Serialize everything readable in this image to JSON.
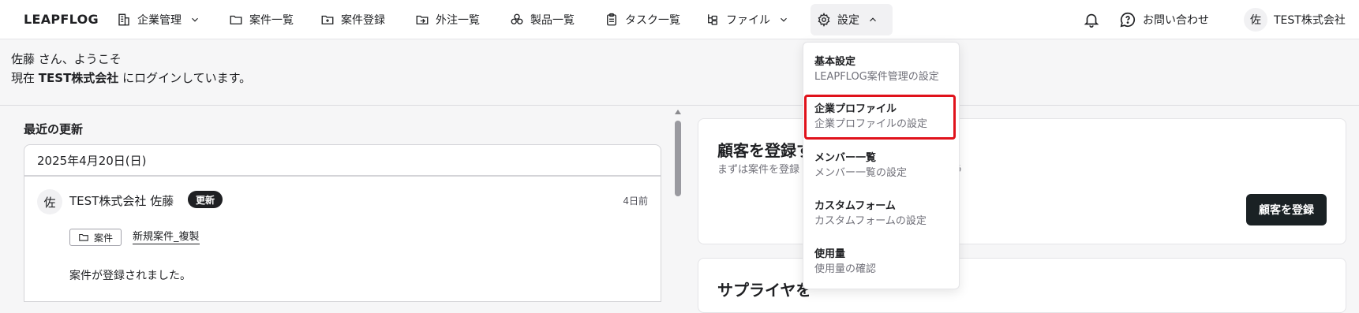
{
  "nav": {
    "brand": "LEAPFLOG",
    "items": [
      {
        "label": "企業管理",
        "icon": "building-icon"
      },
      {
        "label": "案件一覧",
        "icon": "folder-icon"
      },
      {
        "label": "案件登録",
        "icon": "folder-plus-icon"
      },
      {
        "label": "外注一覧",
        "icon": "folder-export-icon"
      },
      {
        "label": "製品一覧",
        "icon": "boxes-icon"
      },
      {
        "label": "タスク一覧",
        "icon": "clipboard-icon"
      },
      {
        "label": "ファイル",
        "icon": "file-tree-icon"
      },
      {
        "label": "設定",
        "icon": "gear-icon"
      }
    ],
    "contact": "お問い合わせ",
    "avatar_initial": "佐",
    "company": "TEST株式会社"
  },
  "welcome": {
    "line1": "佐藤 さん、ようこそ",
    "line2_prefix": "現在 ",
    "line2_company": "TEST株式会社",
    "line2_suffix": " にログインしています。"
  },
  "feed": {
    "title": "最近の更新",
    "date": "2025年4月20日(日)",
    "entry": {
      "avatar_initial": "佐",
      "author": "TEST株式会社  佐藤",
      "badge": "更新",
      "time": "4日前",
      "tag": "案件",
      "case_name": "新規案件_複製",
      "message": "案件が登録されました。"
    }
  },
  "cards": {
    "customer": {
      "title": "顧客を登録す",
      "subtitle": "まずは案件を登録",
      "subtitle_tail": "う",
      "button": "顧客を登録"
    },
    "supplier": {
      "title": "サプライヤを"
    }
  },
  "settings_menu": [
    {
      "title": "基本設定",
      "desc": "LEAPFLOG案件管理の設定"
    },
    {
      "title": "企業プロファイル",
      "desc": "企業プロファイルの設定"
    },
    {
      "title": "メンバー一覧",
      "desc": "メンバー一覧の設定"
    },
    {
      "title": "カスタムフォーム",
      "desc": "カスタムフォームの設定"
    },
    {
      "title": "使用量",
      "desc": "使用量の確認"
    }
  ],
  "colors": {
    "highlight": "#e0121b",
    "badge_bg": "#1f2023",
    "primary_button": "#1a2124"
  }
}
